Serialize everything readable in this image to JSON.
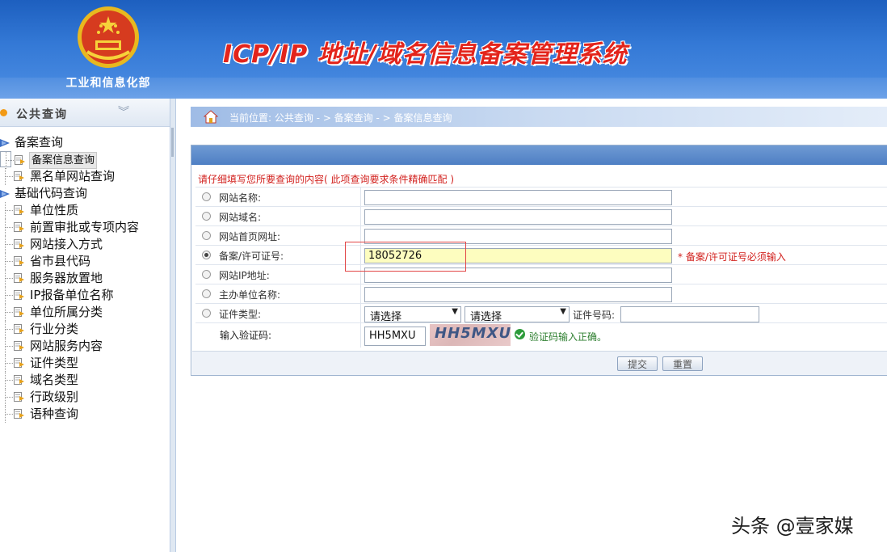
{
  "header": {
    "ministry": "工业和信息化部",
    "system_title": "ICP/IP 地址/域名信息备案管理系统"
  },
  "sidebar": {
    "section_title": "公共查询",
    "categories": [
      {
        "label": "备案查询",
        "items": [
          "备案信息查询",
          "黑名单网站查询"
        ]
      },
      {
        "label": "基础代码查询",
        "items": [
          "单位性质",
          "前置审批或专项内容",
          "网站接入方式",
          "省市县代码",
          "服务器放置地",
          "IP报备单位名称",
          "单位所属分类",
          "行业分类",
          "网站服务内容",
          "证件类型",
          "域名类型",
          "行政级别",
          "语种查询"
        ]
      }
    ],
    "selected": "备案信息查询"
  },
  "breadcrumb": {
    "text": "当前位置: 公共查询  - >  备案查询  - > 备案信息查询"
  },
  "form": {
    "hint": "请仔细填写您所要查询的内容( 此项查询要求条件精确匹配 )",
    "fields": [
      {
        "label": "网站名称:",
        "value": "",
        "checked": false
      },
      {
        "label": "网站域名:",
        "value": "",
        "checked": false
      },
      {
        "label": "网站首页网址:",
        "value": "",
        "checked": false
      },
      {
        "label": "备案/许可证号:",
        "value": "18052726",
        "checked": true,
        "required_note": "* 备案/许可证号必须输入"
      },
      {
        "label": "网站IP地址:",
        "value": "",
        "checked": false
      },
      {
        "label": "主办单位名称:",
        "value": "",
        "checked": false
      }
    ],
    "cert_type": {
      "label": "证件类型:",
      "select1": "请选择",
      "select2": "请选择",
      "id_label": "证件号码:",
      "id_value": ""
    },
    "captcha": {
      "label": "输入验证码:",
      "value": "HH5MXU",
      "image_text": "HH5MXU",
      "status": "验证码输入正确。"
    },
    "buttons": {
      "submit": "提交",
      "reset": "重置"
    }
  },
  "watermark": "头条 @壹家媒",
  "colors": {
    "brand_blue": "#2f6fcf",
    "title_red": "#e3241b",
    "hint_red": "#d2211e",
    "ok_green": "#2d9b3a"
  },
  "icons": {
    "home": "home-icon",
    "emblem": "national-emblem-icon"
  }
}
